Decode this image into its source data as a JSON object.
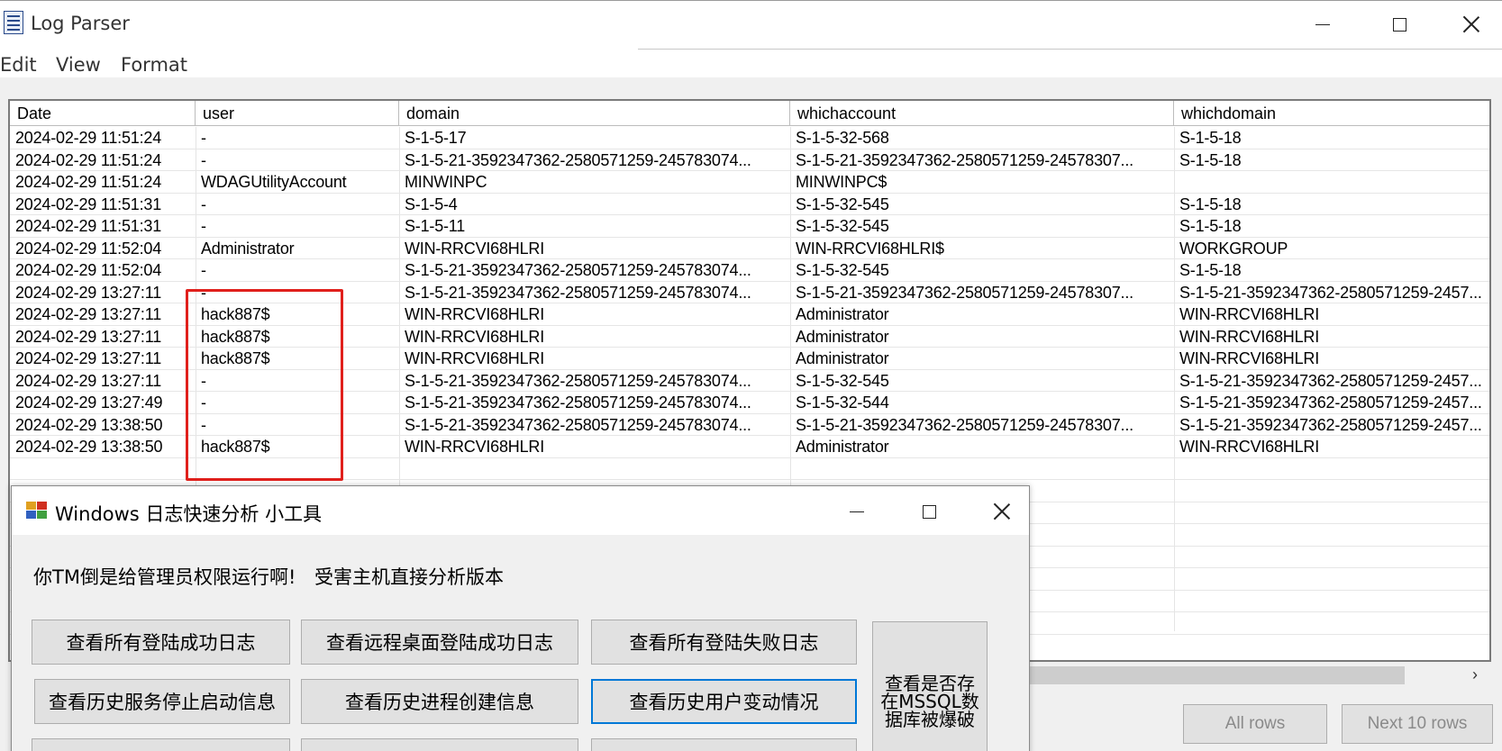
{
  "log_parser": {
    "title": "Log Parser",
    "menu": [
      "Edit",
      "View",
      "Format"
    ],
    "columns": [
      "Date",
      "user",
      "domain",
      "whichaccount",
      "whichdomain"
    ],
    "rows": [
      [
        "2024-02-29 11:51:24",
        "-",
        "S-1-5-17",
        "S-1-5-32-568",
        "S-1-5-18"
      ],
      [
        "2024-02-29 11:51:24",
        "-",
        "S-1-5-21-3592347362-2580571259-245783074...",
        "S-1-5-21-3592347362-2580571259-24578307...",
        "S-1-5-18"
      ],
      [
        "2024-02-29 11:51:24",
        "WDAGUtilityAccount",
        "MINWINPC",
        "MINWINPC$",
        ""
      ],
      [
        "2024-02-29 11:51:31",
        "-",
        "S-1-5-4",
        "S-1-5-32-545",
        "S-1-5-18"
      ],
      [
        "2024-02-29 11:51:31",
        "-",
        "S-1-5-11",
        "S-1-5-32-545",
        "S-1-5-18"
      ],
      [
        "2024-02-29 11:52:04",
        "Administrator",
        "WIN-RRCVI68HLRI",
        "WIN-RRCVI68HLRI$",
        "WORKGROUP"
      ],
      [
        "2024-02-29 11:52:04",
        "-",
        "S-1-5-21-3592347362-2580571259-245783074...",
        "S-1-5-32-545",
        "S-1-5-18"
      ],
      [
        "2024-02-29 13:27:11",
        "-",
        "S-1-5-21-3592347362-2580571259-245783074...",
        "S-1-5-21-3592347362-2580571259-24578307...",
        "S-1-5-21-3592347362-2580571259-2457..."
      ],
      [
        "2024-02-29 13:27:11",
        "hack887$",
        "WIN-RRCVI68HLRI",
        "Administrator",
        "WIN-RRCVI68HLRI"
      ],
      [
        "2024-02-29 13:27:11",
        "hack887$",
        "WIN-RRCVI68HLRI",
        "Administrator",
        "WIN-RRCVI68HLRI"
      ],
      [
        "2024-02-29 13:27:11",
        "hack887$",
        "WIN-RRCVI68HLRI",
        "Administrator",
        "WIN-RRCVI68HLRI"
      ],
      [
        "2024-02-29 13:27:11",
        "-",
        "S-1-5-21-3592347362-2580571259-245783074...",
        "S-1-5-32-545",
        "S-1-5-21-3592347362-2580571259-2457..."
      ],
      [
        "2024-02-29 13:27:49",
        "-",
        "S-1-5-21-3592347362-2580571259-245783074...",
        "S-1-5-32-544",
        "S-1-5-21-3592347362-2580571259-2457..."
      ],
      [
        "2024-02-29 13:38:50",
        "-",
        "S-1-5-21-3592347362-2580571259-245783074...",
        "S-1-5-21-3592347362-2580571259-24578307...",
        "S-1-5-21-3592347362-2580571259-2457..."
      ],
      [
        "2024-02-29 13:38:50",
        "hack887$",
        "WIN-RRCVI68HLRI",
        "Administrator",
        "WIN-RRCVI68HLRI"
      ]
    ],
    "buttons": {
      "all_rows": "All rows",
      "next_rows": "Next 10 rows"
    },
    "scroll_arrow": "›",
    "highlight_color": "#e0201c"
  },
  "dialog": {
    "title": "Windows 日志快速分析 小工具",
    "note_admin": "你TM倒是给管理员权限运行啊!",
    "note_version": "受害主机直接分析版本",
    "buttons": {
      "login_success": "查看所有登陆成功日志",
      "rdp_success": "查看远程桌面登陆成功日志",
      "login_failed": "查看所有登陆失败日志",
      "service_history": "查看历史服务停止启动信息",
      "process_history": "查看历史进程创建信息",
      "user_changes": "查看历史用户变动情况",
      "mssql_line1": "查看是否存",
      "mssql_line2": "在MSSQL数",
      "mssql_line3": "据库被爆破"
    },
    "accent_color": "#0078d7"
  }
}
